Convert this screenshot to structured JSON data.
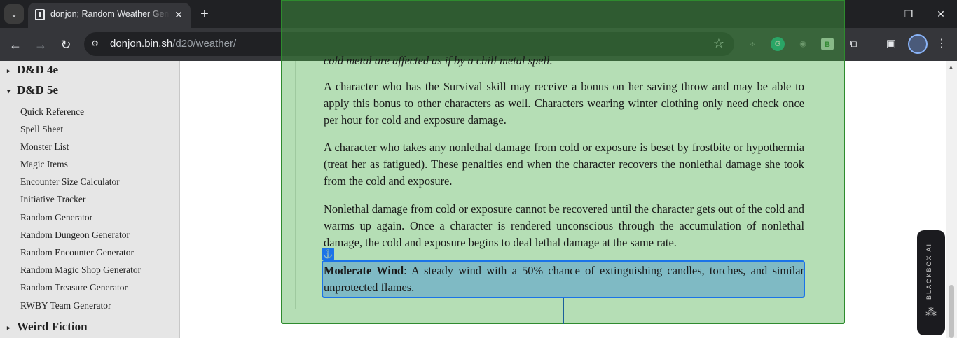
{
  "browser": {
    "tab_title": "donjon; Random Weather Generator",
    "new_tab_label": "+",
    "url_host": "donjon.bin.sh",
    "url_path": "/d20/weather/",
    "ext_icons": [
      "shield-extension-icon",
      "grammarly-icon",
      "camera-extension-icon",
      "b-extension-icon",
      "extensions-puzzle-icon",
      "side-panel-icon",
      "profile-avatar"
    ],
    "ext_b_label": "B",
    "ext_g_label": "G"
  },
  "sidebar": {
    "sections": [
      {
        "label": "D&D 4e",
        "expanded": false
      },
      {
        "label": "D&D 5e",
        "expanded": true
      },
      {
        "label": "Weird Fiction",
        "expanded": false
      }
    ],
    "items": [
      {
        "label": "Quick Reference"
      },
      {
        "label": "Spell Sheet"
      },
      {
        "label": "Monster List"
      },
      {
        "label": "Magic Items"
      },
      {
        "label": "Encounter Size Calculator"
      },
      {
        "label": "Initiative Tracker"
      },
      {
        "label": "Random Generator"
      },
      {
        "label": "Random Dungeon Generator"
      },
      {
        "label": "Random Encounter Generator"
      },
      {
        "label": "Random Magic Shop Generator"
      },
      {
        "label": "Random Treasure Generator"
      },
      {
        "label": "RWBY Team Generator"
      }
    ]
  },
  "content": {
    "partial_top": "cold metal are affected as if by a chill metal spell.",
    "paragraphs": [
      "A character who has the Survival skill may receive a bonus on her saving throw and may be able to apply this bonus to other characters as well. Characters wearing winter clothing only need check once per hour for cold and exposure damage.",
      "A character who takes any nonlethal damage from cold or exposure is beset by frostbite or hypothermia (treat her as fatigued). These penalties end when the character recovers the nonlethal damage she took from the cold and exposure.",
      "Nonlethal damage from cold or exposure cannot be recovered until the character gets out of the cold and warms up again. Once a character is rendered unconscious through the accumulation of nonlethal damage, the cold and exposure begins to deal lethal damage at the same rate."
    ],
    "highlight_term": "Moderate Wind",
    "highlight_text": ": A steady wind with a 50% chance of extinguishing candles, torches, and similar unprotected flames."
  },
  "widget": {
    "label": "BLACKBOX AI"
  },
  "colors": {
    "panel_bg": "#b5deb5",
    "panel_border": "#2e8b2e",
    "highlight_bg": "#7fbac4",
    "highlight_border": "#1a73e8"
  }
}
